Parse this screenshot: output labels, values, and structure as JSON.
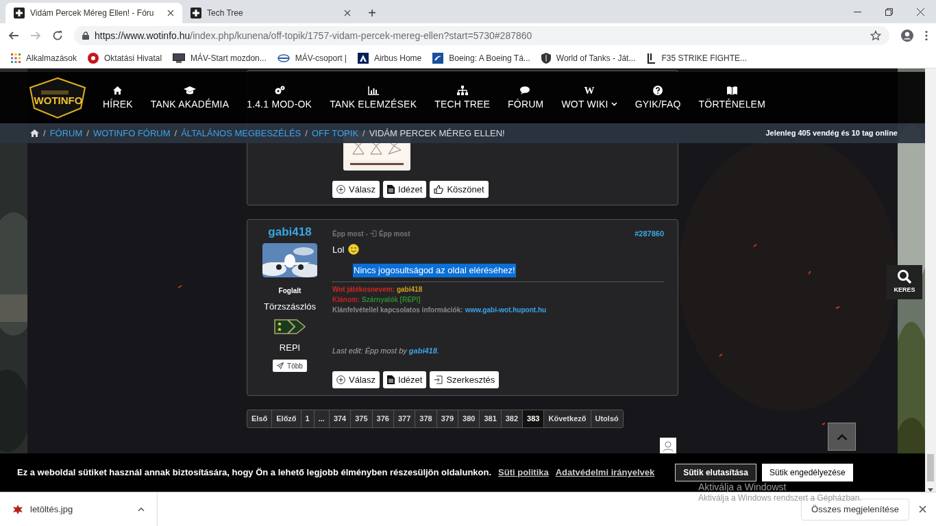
{
  "browser": {
    "tabs": [
      {
        "title": "Vidám Percek Méreg Ellen! - Fóru",
        "selected": true
      },
      {
        "title": "Tech Tree",
        "selected": false
      }
    ],
    "new_tab": "+",
    "url_host": "https://www.wotinfo.hu",
    "url_path": "/index.php/kunena/off-topik/1757-vidam-percek-mereg-ellen?start=5730#287860",
    "bookmarks": [
      {
        "label": "Alkalmazások",
        "kind": "apps"
      },
      {
        "label": "Oktatási Hivatal",
        "kind": "hu"
      },
      {
        "label": "MÁV-Start mozdon...",
        "kind": "screen"
      },
      {
        "label": "MÁV-csoport |",
        "kind": "mav"
      },
      {
        "label": "Airbus Home",
        "kind": "airbus"
      },
      {
        "label": "Boeing: A Boeing Tá...",
        "kind": "boeing"
      },
      {
        "label": "World of Tanks - Ját...",
        "kind": "wot"
      },
      {
        "label": "F35 STRIKE FIGHTE...",
        "kind": "f35"
      }
    ]
  },
  "site": {
    "logo": "WOTINFO",
    "nav": [
      {
        "label": "HÍREK",
        "kind": "home"
      },
      {
        "label": "TANK AKADÉMIA",
        "kind": "cap"
      },
      {
        "label": "1.4.1 MOD-OK",
        "kind": "cogs"
      },
      {
        "label": "TANK ELEMZÉSEK",
        "kind": "chart"
      },
      {
        "label": "TECH TREE",
        "kind": "sitemap"
      },
      {
        "label": "FÓRUM",
        "kind": "comments"
      },
      {
        "label": "WOT WIKI",
        "kind": "glyph",
        "glyph": "W",
        "dropdown": true
      },
      {
        "label": "GYIK/FAQ",
        "kind": "question"
      },
      {
        "label": "TÖRTÉNELEM",
        "kind": "book"
      }
    ],
    "breadcrumb": [
      {
        "separator": "/",
        "label": "FÓRUM",
        "link": true
      },
      {
        "separator": "/",
        "label": "WOTINFO FÓRUM",
        "link": true
      },
      {
        "separator": "/",
        "label": "ÁLTALÁNOS MEGBESZÉLÉS",
        "link": true
      },
      {
        "separator": "/",
        "label": "OFF TOPIK",
        "link": true
      },
      {
        "separator": "/",
        "label": "VIDÁM PERCEK MÉREG ELLEN!",
        "link": false
      }
    ],
    "online": "Jelenleg 405 vendég és 10 tag online",
    "search_label": "KERES"
  },
  "previous_post": {
    "buttons": [
      {
        "label": "Válasz",
        "kind": "reply"
      },
      {
        "label": "Idézet",
        "kind": "quote"
      },
      {
        "label": "Köszönet",
        "kind": "thanks"
      }
    ]
  },
  "post": {
    "author": "gabi418",
    "status": "Foglalt",
    "rank": "Törzszászlós",
    "clan": "REPI",
    "more": "Több",
    "time": "Épp most",
    "separator": "-",
    "edited": "Épp most",
    "number": "#287860",
    "body": "Lol",
    "quote": "Nincs jogosultságod az oldal eléréséhez!",
    "signature": [
      {
        "label": "Wot játékosnevem:",
        "value": "gabi418",
        "kind": "name"
      },
      {
        "label": "Klánom:",
        "value": "Szárnyalók [REPI]",
        "kind": "clan"
      },
      {
        "label": "Klánfelvétellel kapcsolatos információk:",
        "value": "www.gabi-wot.hupont.hu",
        "kind": "link"
      }
    ],
    "last_edit": {
      "prefix": "Last edit: Épp most by",
      "user": "gabi418",
      "suffix": "."
    },
    "buttons": [
      {
        "label": "Válasz",
        "kind": "reply"
      },
      {
        "label": "Idézet",
        "kind": "quote"
      },
      {
        "label": "Szerkesztés",
        "kind": "edit"
      }
    ]
  },
  "pagination": [
    {
      "label": "Első",
      "selected": false
    },
    {
      "label": "Előző",
      "selected": false
    },
    {
      "label": "1",
      "selected": false
    },
    {
      "label": "...",
      "selected": false
    },
    {
      "label": "374",
      "selected": false
    },
    {
      "label": "375",
      "selected": false
    },
    {
      "label": "376",
      "selected": false
    },
    {
      "label": "377",
      "selected": false
    },
    {
      "label": "378",
      "selected": false
    },
    {
      "label": "379",
      "selected": false
    },
    {
      "label": "380",
      "selected": false
    },
    {
      "label": "381",
      "selected": false
    },
    {
      "label": "382",
      "selected": false
    },
    {
      "label": "383",
      "selected": true
    },
    {
      "label": "Következő",
      "selected": false
    },
    {
      "label": "Utolsó",
      "selected": false
    }
  ],
  "cookie_bar": {
    "text": "Ez a weboldal sütiket használ annak biztosítására, hogy Ön a lehető legjobb élményben részesüljön oldalunkon.",
    "links": [
      "Süti politika",
      "Adatvédelmi irányelvek"
    ],
    "buttons": [
      {
        "label": "Sütik elutasítása",
        "kind": "outline"
      },
      {
        "label": "Sütik engedélyezése",
        "kind": "solid"
      }
    ]
  },
  "os_notice": [
    "Aktiválja a Windowst",
    "Aktiválja a Windows rendszert a Gépházban."
  ],
  "download_bar": {
    "file": "letöltés.jpg",
    "show_all": "Összes megjelenítése"
  }
}
